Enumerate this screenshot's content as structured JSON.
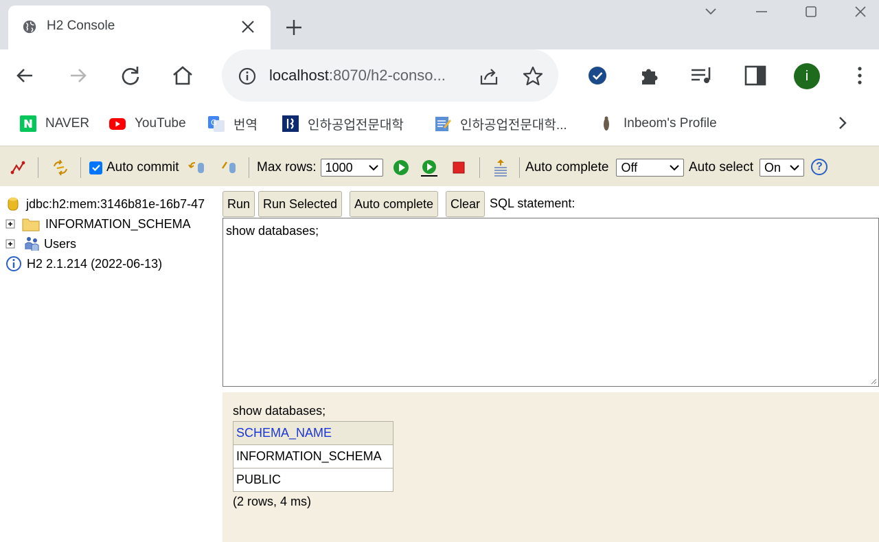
{
  "browser": {
    "tab_title": "H2 Console",
    "url_host": "localhost",
    "url_rest": ":8070/h2-conso...",
    "avatar_letter": "i",
    "accent_color": "#1e6b1e"
  },
  "bookmarks": [
    {
      "label": "NAVER",
      "icon": "naver-icon"
    },
    {
      "label": "YouTube",
      "icon": "youtube-icon"
    },
    {
      "label": "번역",
      "icon": "translate-icon"
    },
    {
      "label": "인하공업전문대학",
      "icon": "inha-logo-icon"
    },
    {
      "label": "인하공업전문대학...",
      "icon": "notepad-icon"
    },
    {
      "label": "Inbeom's Profile",
      "icon": "profile-icon"
    }
  ],
  "h2toolbar": {
    "auto_commit_label": "Auto commit",
    "auto_commit_checked": true,
    "max_rows_label": "Max rows:",
    "max_rows_value": "1000",
    "auto_complete_label": "Auto complete",
    "auto_complete_value": "Off",
    "auto_select_label": "Auto select",
    "auto_select_value": "On",
    "help_label": "?"
  },
  "tree": {
    "connection": "jdbc:h2:mem:3146b81e-16b7-47",
    "items": [
      {
        "label": "INFORMATION_SCHEMA",
        "icon": "folder-icon"
      },
      {
        "label": "Users",
        "icon": "users-icon"
      }
    ],
    "version": "H2 2.1.214 (2022-06-13)"
  },
  "query": {
    "run_label": "Run",
    "run_selected_label": "Run Selected",
    "auto_complete_label": "Auto complete",
    "clear_label": "Clear",
    "sql_label": "SQL statement:",
    "sql_text": "show databases;"
  },
  "result": {
    "query": "show databases;",
    "column": "SCHEMA_NAME",
    "rows": [
      "INFORMATION_SCHEMA",
      "PUBLIC"
    ],
    "footer": "(2 rows, 4 ms)"
  }
}
